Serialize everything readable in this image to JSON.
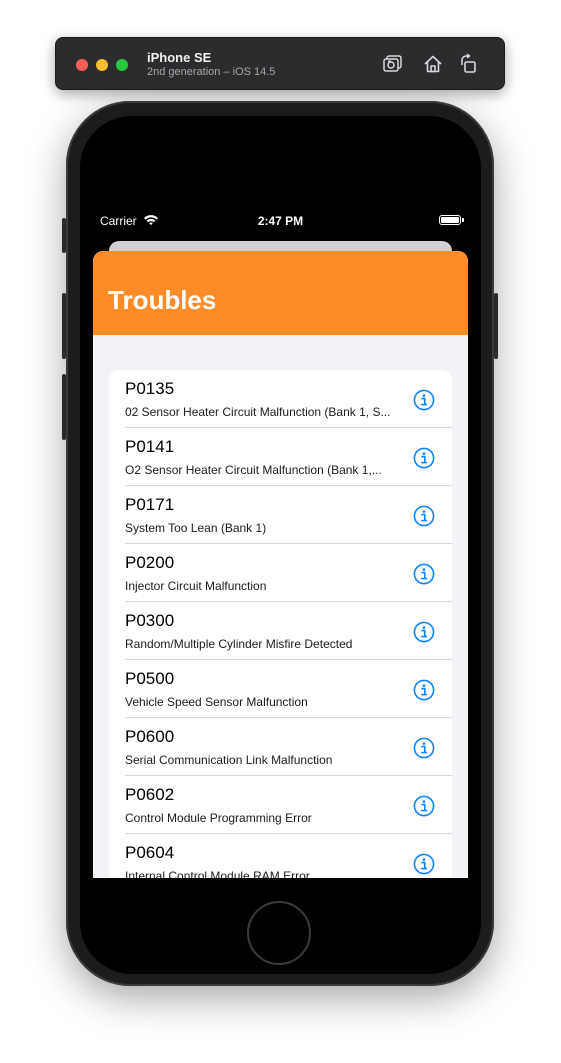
{
  "simulator": {
    "device_name": "iPhone SE",
    "device_detail": "2nd generation – iOS 14.5",
    "icons": [
      "screenshot-icon",
      "home-icon",
      "rotate-icon"
    ]
  },
  "status_bar": {
    "carrier": "Carrier",
    "time": "2:47 PM",
    "icons": [
      "wifi-icon",
      "battery-icon"
    ]
  },
  "nav": {
    "title": "Troubles",
    "color": "#ff8c28"
  },
  "accent_color": "#0a84ff",
  "troubles": [
    {
      "code": "P0135",
      "description": "02 Sensor Heater Circuit Malfunction (Bank 1, S..."
    },
    {
      "code": "P0141",
      "description": "O2 Sensor Heater Circuit Malfunction (Bank 1,..."
    },
    {
      "code": "P0171",
      "description": "System Too Lean (Bank 1)"
    },
    {
      "code": "P0200",
      "description": "Injector Circuit Malfunction"
    },
    {
      "code": "P0300",
      "description": "Random/Multiple Cylinder Misfire Detected"
    },
    {
      "code": "P0500",
      "description": "Vehicle Speed Sensor Malfunction"
    },
    {
      "code": "P0600",
      "description": "Serial Communication Link Malfunction"
    },
    {
      "code": "P0602",
      "description": "Control Module Programming Error"
    },
    {
      "code": "P0604",
      "description": "Internal Control Module RAM Error"
    }
  ]
}
